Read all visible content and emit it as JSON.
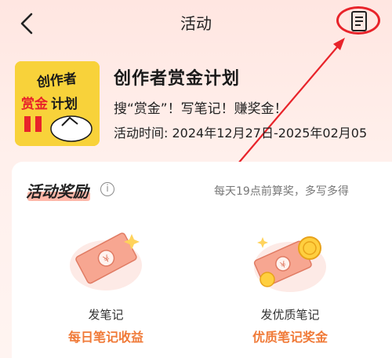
{
  "header": {
    "title": "活动",
    "back_icon": "chevron-left-icon",
    "rules_icon": "document-icon",
    "highlight_color": "#e8232a"
  },
  "activity": {
    "banner": {
      "line1": "创作者",
      "line2_a": "赏金",
      "line2_b": "计划",
      "bg_color": "#f8d23a"
    },
    "title": "创作者赏金计划",
    "subtitle": "搜“赏金”！写笔记！赚奖金！",
    "time_label": "活动时间:",
    "time_value": "2024年12月27日-2025年02月05"
  },
  "rewards": {
    "heading": "活动奖励",
    "info_icon": "info-icon",
    "note": "每天19点前算奖，多写多得",
    "accent_color": "#f07a38",
    "items": [
      {
        "label": "发笔记",
        "sublabel": "每日笔记收益",
        "icon": "money-bill-icon"
      },
      {
        "label": "发优质笔记",
        "sublabel": "优质笔记奖金",
        "icon": "money-coins-icon"
      }
    ]
  }
}
